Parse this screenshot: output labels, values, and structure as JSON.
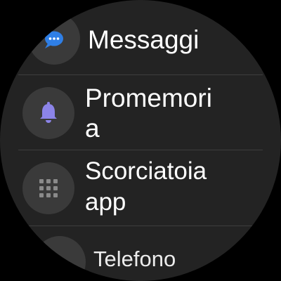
{
  "apps": [
    {
      "label": "Messaggi",
      "icon": "chat-bubble-icon",
      "icon_color": "#2f7fe6"
    },
    {
      "label_line1": "Promemori",
      "label_line2": "a",
      "icon": "bell-icon",
      "icon_color": "#8c84e8"
    },
    {
      "label_line1": "Scorciatoia",
      "label_line2": "app",
      "icon": "app-grid-icon",
      "icon_color": "#8a8a8a"
    },
    {
      "label": "Telefono",
      "icon": "phone-icon",
      "icon_color": "#2fb86a"
    }
  ]
}
